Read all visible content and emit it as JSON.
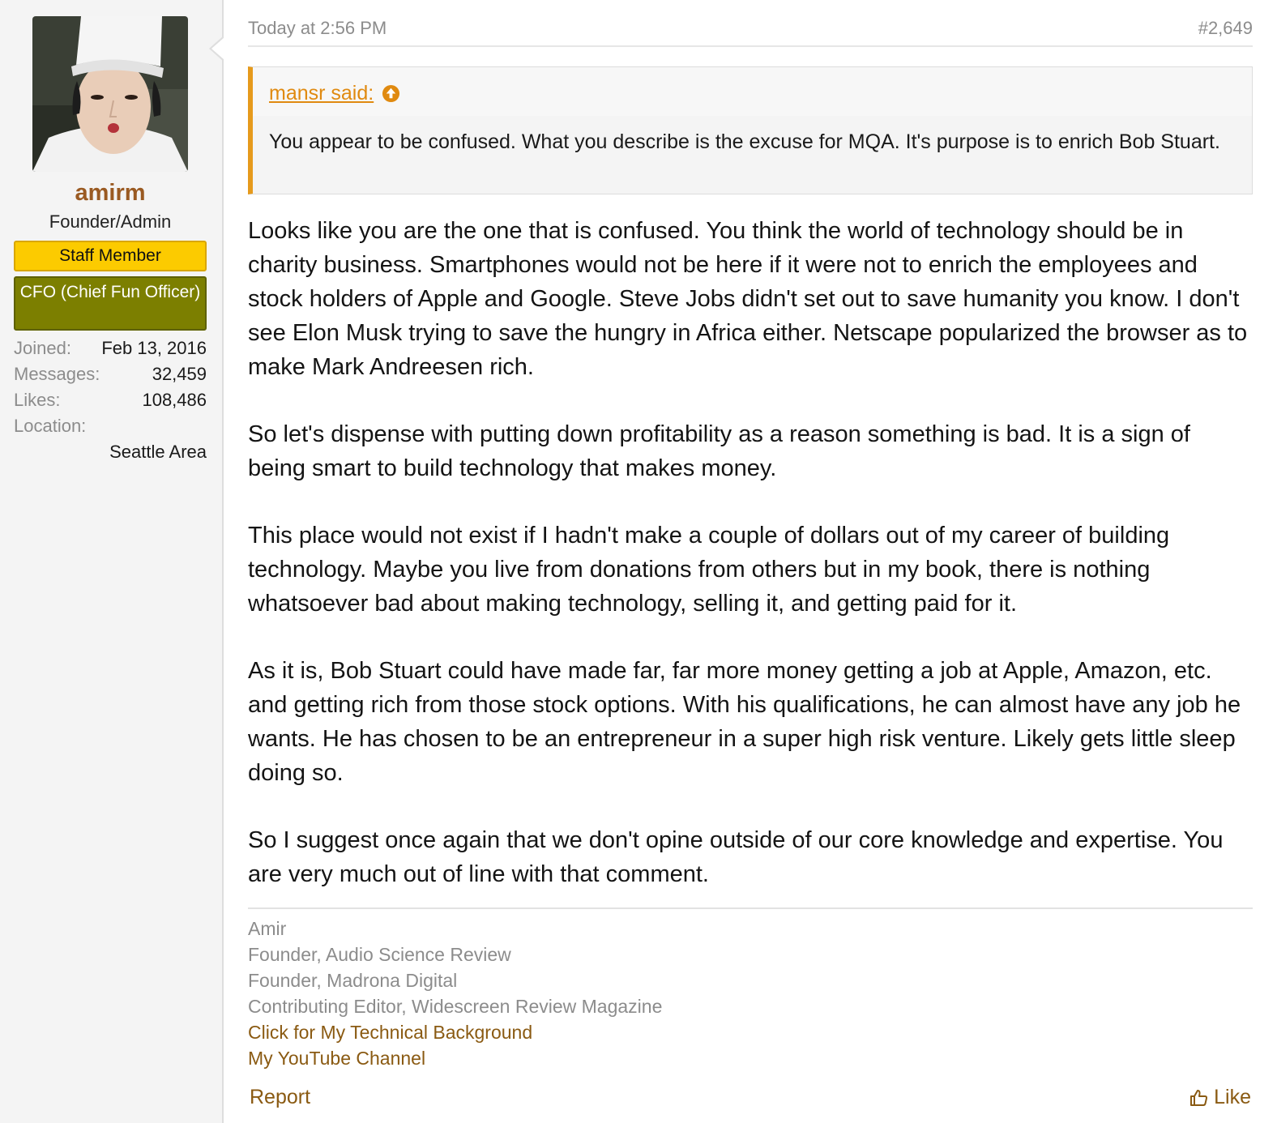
{
  "user": {
    "username": "amirm",
    "title": "Founder/Admin",
    "badges": [
      "Staff Member",
      "CFO (Chief Fun Officer)"
    ],
    "stats": {
      "joined_label": "Joined:",
      "joined": "Feb 13, 2016",
      "messages_label": "Messages:",
      "messages": "32,459",
      "likes_label": "Likes:",
      "likes": "108,486",
      "location_label": "Location:",
      "location": "Seattle Area"
    }
  },
  "post": {
    "date": "Today at 2:56 PM",
    "number": "#2,649",
    "quote": {
      "author": "mansr said:",
      "icon": "arrow-up-circle-icon",
      "text": "You appear to be confused. What you describe is the excuse for MQA. It's purpose is to enrich Bob Stuart."
    },
    "paragraphs": [
      "Looks like you are the one that is confused. You think the world of technology should be in charity business. Smartphones would not be here if it were not to enrich the employees and stock holders of Apple and Google. Steve Jobs didn't set out to save humanity you know. I don't see Elon Musk trying to save the hungry in Africa either. Netscape popularized the browser as to make Mark Andreesen rich.",
      "So let's dispense with putting down profitability as a reason something is bad. It is a sign of being smart to build technology that makes money.",
      "This place would not exist if I hadn't make a couple of dollars out of my career of building technology. Maybe you live from donations from others but in my book, there is nothing whatsoever bad about making technology, selling it, and getting paid for it.",
      "As it is, Bob Stuart could have made far, far more money getting a job at Apple, Amazon, etc. and getting rich from those stock options. With his qualifications, he can almost have any job he wants. He has chosen to be an entrepreneur in a super high risk venture. Likely gets little sleep doing so.",
      "So I suggest once again that we don't opine outside of our core knowledge and expertise. You are very much out of line with that comment."
    ],
    "signature": {
      "lines": [
        "Amir",
        "Founder, Audio Science Review",
        "Founder, Madrona Digital",
        "Contributing Editor, Widescreen Review Magazine"
      ],
      "links": [
        "Click for My Technical Background",
        "My YouTube Channel"
      ]
    },
    "actions": {
      "report": "Report",
      "like": "Like",
      "like_icon": "thumbs-up-icon"
    }
  },
  "colors": {
    "username": "#9a5a22",
    "staff_badge": "#fccb00",
    "cfo_badge": "#7c7f00",
    "quote_accent": "#e69a1c",
    "link": "#8a5a12"
  }
}
